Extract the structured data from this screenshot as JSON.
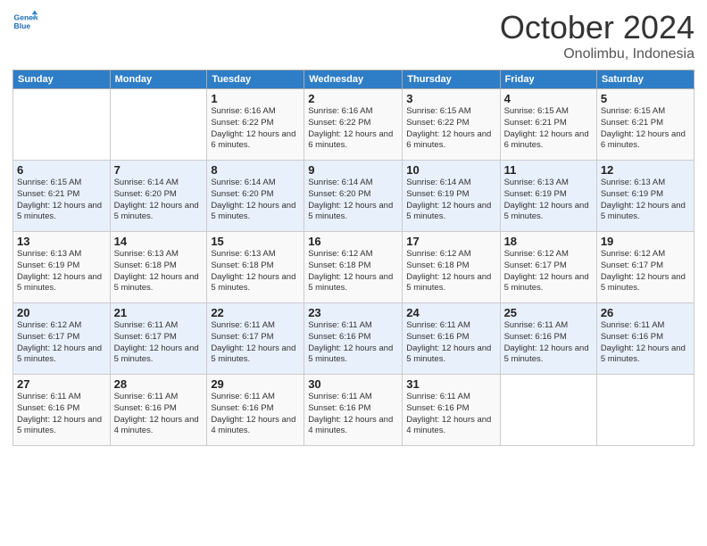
{
  "logo": {
    "line1": "General",
    "line2": "Blue"
  },
  "title": "October 2024",
  "subtitle": "Onolimbu, Indonesia",
  "weekdays": [
    "Sunday",
    "Monday",
    "Tuesday",
    "Wednesday",
    "Thursday",
    "Friday",
    "Saturday"
  ],
  "weeks": [
    [
      {
        "day": "",
        "info": ""
      },
      {
        "day": "",
        "info": ""
      },
      {
        "day": "1",
        "info": "Sunrise: 6:16 AM\nSunset: 6:22 PM\nDaylight: 12 hours\nand 6 minutes."
      },
      {
        "day": "2",
        "info": "Sunrise: 6:16 AM\nSunset: 6:22 PM\nDaylight: 12 hours\nand 6 minutes."
      },
      {
        "day": "3",
        "info": "Sunrise: 6:15 AM\nSunset: 6:22 PM\nDaylight: 12 hours\nand 6 minutes."
      },
      {
        "day": "4",
        "info": "Sunrise: 6:15 AM\nSunset: 6:21 PM\nDaylight: 12 hours\nand 6 minutes."
      },
      {
        "day": "5",
        "info": "Sunrise: 6:15 AM\nSunset: 6:21 PM\nDaylight: 12 hours\nand 6 minutes."
      }
    ],
    [
      {
        "day": "6",
        "info": "Sunrise: 6:15 AM\nSunset: 6:21 PM\nDaylight: 12 hours\nand 5 minutes."
      },
      {
        "day": "7",
        "info": "Sunrise: 6:14 AM\nSunset: 6:20 PM\nDaylight: 12 hours\nand 5 minutes."
      },
      {
        "day": "8",
        "info": "Sunrise: 6:14 AM\nSunset: 6:20 PM\nDaylight: 12 hours\nand 5 minutes."
      },
      {
        "day": "9",
        "info": "Sunrise: 6:14 AM\nSunset: 6:20 PM\nDaylight: 12 hours\nand 5 minutes."
      },
      {
        "day": "10",
        "info": "Sunrise: 6:14 AM\nSunset: 6:19 PM\nDaylight: 12 hours\nand 5 minutes."
      },
      {
        "day": "11",
        "info": "Sunrise: 6:13 AM\nSunset: 6:19 PM\nDaylight: 12 hours\nand 5 minutes."
      },
      {
        "day": "12",
        "info": "Sunrise: 6:13 AM\nSunset: 6:19 PM\nDaylight: 12 hours\nand 5 minutes."
      }
    ],
    [
      {
        "day": "13",
        "info": "Sunrise: 6:13 AM\nSunset: 6:19 PM\nDaylight: 12 hours\nand 5 minutes."
      },
      {
        "day": "14",
        "info": "Sunrise: 6:13 AM\nSunset: 6:18 PM\nDaylight: 12 hours\nand 5 minutes."
      },
      {
        "day": "15",
        "info": "Sunrise: 6:13 AM\nSunset: 6:18 PM\nDaylight: 12 hours\nand 5 minutes."
      },
      {
        "day": "16",
        "info": "Sunrise: 6:12 AM\nSunset: 6:18 PM\nDaylight: 12 hours\nand 5 minutes."
      },
      {
        "day": "17",
        "info": "Sunrise: 6:12 AM\nSunset: 6:18 PM\nDaylight: 12 hours\nand 5 minutes."
      },
      {
        "day": "18",
        "info": "Sunrise: 6:12 AM\nSunset: 6:17 PM\nDaylight: 12 hours\nand 5 minutes."
      },
      {
        "day": "19",
        "info": "Sunrise: 6:12 AM\nSunset: 6:17 PM\nDaylight: 12 hours\nand 5 minutes."
      }
    ],
    [
      {
        "day": "20",
        "info": "Sunrise: 6:12 AM\nSunset: 6:17 PM\nDaylight: 12 hours\nand 5 minutes."
      },
      {
        "day": "21",
        "info": "Sunrise: 6:11 AM\nSunset: 6:17 PM\nDaylight: 12 hours\nand 5 minutes."
      },
      {
        "day": "22",
        "info": "Sunrise: 6:11 AM\nSunset: 6:17 PM\nDaylight: 12 hours\nand 5 minutes."
      },
      {
        "day": "23",
        "info": "Sunrise: 6:11 AM\nSunset: 6:16 PM\nDaylight: 12 hours\nand 5 minutes."
      },
      {
        "day": "24",
        "info": "Sunrise: 6:11 AM\nSunset: 6:16 PM\nDaylight: 12 hours\nand 5 minutes."
      },
      {
        "day": "25",
        "info": "Sunrise: 6:11 AM\nSunset: 6:16 PM\nDaylight: 12 hours\nand 5 minutes."
      },
      {
        "day": "26",
        "info": "Sunrise: 6:11 AM\nSunset: 6:16 PM\nDaylight: 12 hours\nand 5 minutes."
      }
    ],
    [
      {
        "day": "27",
        "info": "Sunrise: 6:11 AM\nSunset: 6:16 PM\nDaylight: 12 hours\nand 5 minutes."
      },
      {
        "day": "28",
        "info": "Sunrise: 6:11 AM\nSunset: 6:16 PM\nDaylight: 12 hours\nand 4 minutes."
      },
      {
        "day": "29",
        "info": "Sunrise: 6:11 AM\nSunset: 6:16 PM\nDaylight: 12 hours\nand 4 minutes."
      },
      {
        "day": "30",
        "info": "Sunrise: 6:11 AM\nSunset: 6:16 PM\nDaylight: 12 hours\nand 4 minutes."
      },
      {
        "day": "31",
        "info": "Sunrise: 6:11 AM\nSunset: 6:16 PM\nDaylight: 12 hours\nand 4 minutes."
      },
      {
        "day": "",
        "info": ""
      },
      {
        "day": "",
        "info": ""
      }
    ]
  ]
}
